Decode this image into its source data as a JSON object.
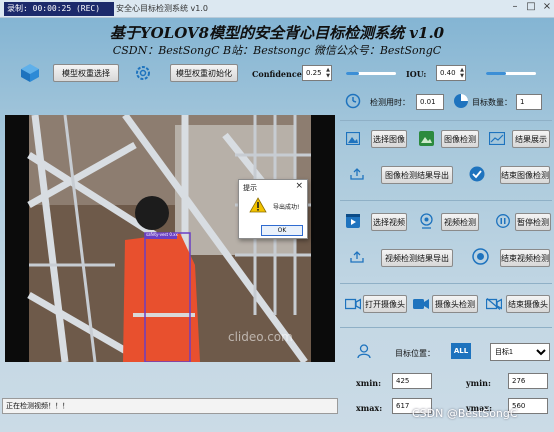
{
  "titlebar": {
    "recording": "录制: 00:00:25 (REC)",
    "window_title": "安全心目标检测系统 v1.0",
    "minimize": "–",
    "maximize": "□",
    "close": "×"
  },
  "header": {
    "title": "基于YOLOV8模型的安全背心目标检测系统 v1.0",
    "subtitle": "CSDN：BestSongC   B站：Bestsongc   微信公众号：BestSongC"
  },
  "toolbar": {
    "select_weights": "模型权重选择",
    "init_weights": "模型权重初始化",
    "confidence_label": "Confidence:",
    "confidence_value": "0.25",
    "confidence_level": 0.25,
    "iou_label": "IOU:",
    "iou_value": "0.40",
    "iou_level": 0.4
  },
  "stats": {
    "time_label": "检测用时：",
    "time_value": "0.01",
    "count_label": "目标数量：",
    "count_value": "1"
  },
  "image_section": {
    "select_image": "选择图像",
    "detect_image": "图像检测",
    "show_result": "结果展示",
    "export_result": "图像检测结果导出",
    "end_detect": "结束图像检测"
  },
  "video_section": {
    "select_video": "选择视频",
    "detect_video": "视频检测",
    "pause_detect": "暂停检测",
    "export_result": "视频检测结果导出",
    "end_detect": "结束视频检测"
  },
  "camera_section": {
    "open_camera": "打开摄像头",
    "detect_camera": "摄像头检测",
    "close_camera": "结束摄像头"
  },
  "target": {
    "label": "目标位置：",
    "all_badge": "ALL",
    "selected": "目标1",
    "xmin_label": "xmin:",
    "xmin_value": "425",
    "ymin_label": "ymin:",
    "ymin_value": "276",
    "xmax_label": "xmax:",
    "xmax_value": "617",
    "ymax_label": "ymax:",
    "ymax_value": "560"
  },
  "video_view": {
    "detection_label": "safety-vest 0.xx",
    "watermark": "clideo.com"
  },
  "dialog": {
    "title": "提示",
    "close": "×",
    "message": "导出成功!",
    "ok": "OK"
  },
  "status_bar": {
    "text": "正在检测视频！！！"
  },
  "footer": {
    "csdn": "CSDN @BestSongC"
  },
  "colors": {
    "accent": "#1e73be",
    "vest": "#e8502e",
    "bbox": "#6a3fc4"
  }
}
